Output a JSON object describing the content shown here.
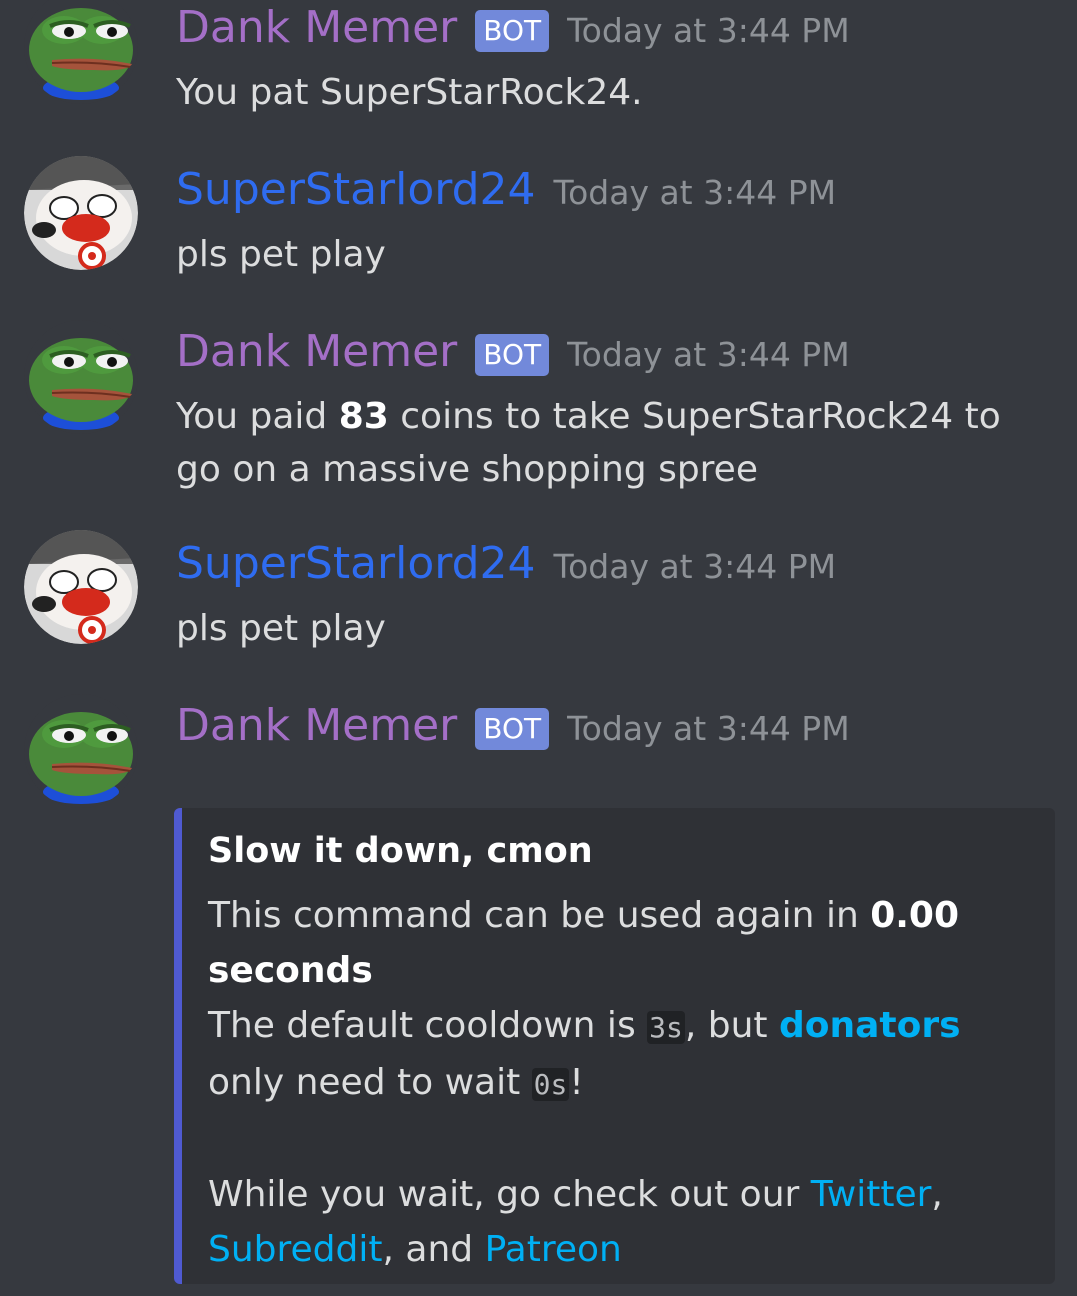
{
  "messages": [
    {
      "username": "Dank Memer",
      "bot_tag": "BOT",
      "timestamp": "Today at 3:44 PM",
      "text": "You pat SuperStarRock24.",
      "avatar": "pepe-frog-avatar"
    },
    {
      "username": "SuperStarlord24",
      "timestamp": "Today at 3:44 PM",
      "text": "pls pet play",
      "avatar": "cartoon-character-avatar"
    },
    {
      "username": "Dank Memer",
      "bot_tag": "BOT",
      "timestamp": "Today at 3:44 PM",
      "text_before": "You paid ",
      "text_bold": "83",
      "text_after": " coins to take SuperStarRock24 to go on a massive shopping spree",
      "avatar": "pepe-frog-avatar"
    },
    {
      "username": "SuperStarlord24",
      "timestamp": "Today at 3:44 PM",
      "text": "pls pet play",
      "avatar": "cartoon-character-avatar"
    },
    {
      "username": "Dank Memer",
      "bot_tag": "BOT",
      "timestamp": "Today at 3:44 PM",
      "avatar": "pepe-frog-avatar",
      "embed": {
        "title": "Slow it down, cmon",
        "line1_text": "This command can be used again in ",
        "line1_bold": "0.00 seconds",
        "line2_a": "The default cooldown is ",
        "line2_code1": "3s",
        "line2_b": ", but ",
        "line2_link": "donators",
        "line2_c": " only need to wait ",
        "line2_code2": "0s",
        "line2_d": "!",
        "line3_a": "While you wait, go check out our ",
        "link_twitter": "Twitter",
        "line3_b": ", ",
        "link_subreddit": "Subreddit",
        "line3_c": ", and ",
        "link_patreon": "Patreon"
      }
    }
  ],
  "colors": {
    "background": "#36393f",
    "bot_username": "#a46fc7",
    "user_username": "#2f6cf0",
    "bot_tag": "#7289da",
    "timestamp": "#8e9297",
    "embed_background": "#2f3136",
    "embed_border": "#4f5ad1",
    "link": "#00b0f4"
  }
}
